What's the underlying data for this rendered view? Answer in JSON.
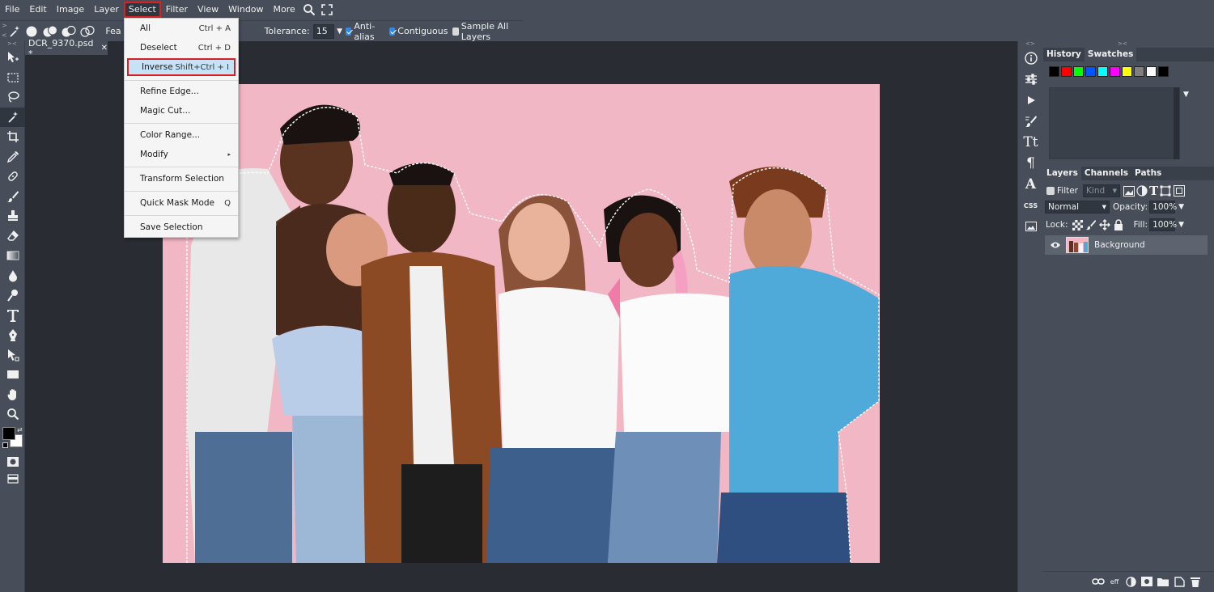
{
  "menubar": {
    "items": [
      "File",
      "Edit",
      "Image",
      "Layer",
      "Select",
      "Filter",
      "View",
      "Window",
      "More"
    ],
    "active": "Select"
  },
  "options": {
    "feather_label_partial": "Fea",
    "tolerance_label": "Tolerance:",
    "tolerance_value": "15",
    "anti_alias_label": "Anti-alias",
    "anti_alias_checked": true,
    "contiguous_label": "Contiguous",
    "contiguous_checked": true,
    "sample_all_label": "Sample All Layers",
    "sample_all_checked": false
  },
  "document": {
    "tab_title": "DCR_9370.psd *",
    "close_glyph": "✕",
    "canvas_background": "#f2b7c4"
  },
  "select_menu": {
    "items": [
      {
        "label": "All",
        "shortcut": "Ctrl + A"
      },
      {
        "label": "Deselect",
        "shortcut": "Ctrl + D"
      },
      {
        "label": "Inverse",
        "shortcut": "Shift+Ctrl + I",
        "highlighted": true
      },
      {
        "label": "Refine Edge...",
        "shortcut": ""
      },
      {
        "label": "Magic Cut...",
        "shortcut": ""
      },
      {
        "label": "Color Range...",
        "shortcut": ""
      },
      {
        "label": "Modify",
        "shortcut": "▸"
      },
      {
        "label": "Transform Selection",
        "shortcut": ""
      },
      {
        "label": "Quick Mask Mode",
        "shortcut": "Q"
      },
      {
        "label": "Save Selection",
        "shortcut": ""
      }
    ]
  },
  "history_panel": {
    "tabs": [
      "History",
      "Swatches"
    ],
    "active_tab": "Swatches",
    "swatches": [
      "#000000",
      "#ff0000",
      "#00ff00",
      "#0055ff",
      "#00ffff",
      "#ff00ff",
      "#ffff00",
      "#808080",
      "#ffffff",
      "#000000"
    ]
  },
  "layers_panel": {
    "tabs": [
      "Layers",
      "Channels",
      "Paths"
    ],
    "active_tab": "Layers",
    "filter_label": "Filter",
    "kind_placeholder": "Kind",
    "blend_mode": "Normal",
    "opacity_label": "Opacity:",
    "opacity_value": "100%",
    "lock_label": "Lock:",
    "fill_label": "Fill:",
    "fill_value": "100%",
    "layers": [
      {
        "name": "Background",
        "visible": true
      }
    ]
  },
  "right_icons": {
    "css_label": "CSS",
    "eff_label": "eff"
  },
  "colors": {
    "panel_bg": "#474e59",
    "dark_bg": "#292d33",
    "accent_blue": "#2d8ae6",
    "highlight_red": "#d42020",
    "menu_highlight": "#c6e2f7"
  }
}
